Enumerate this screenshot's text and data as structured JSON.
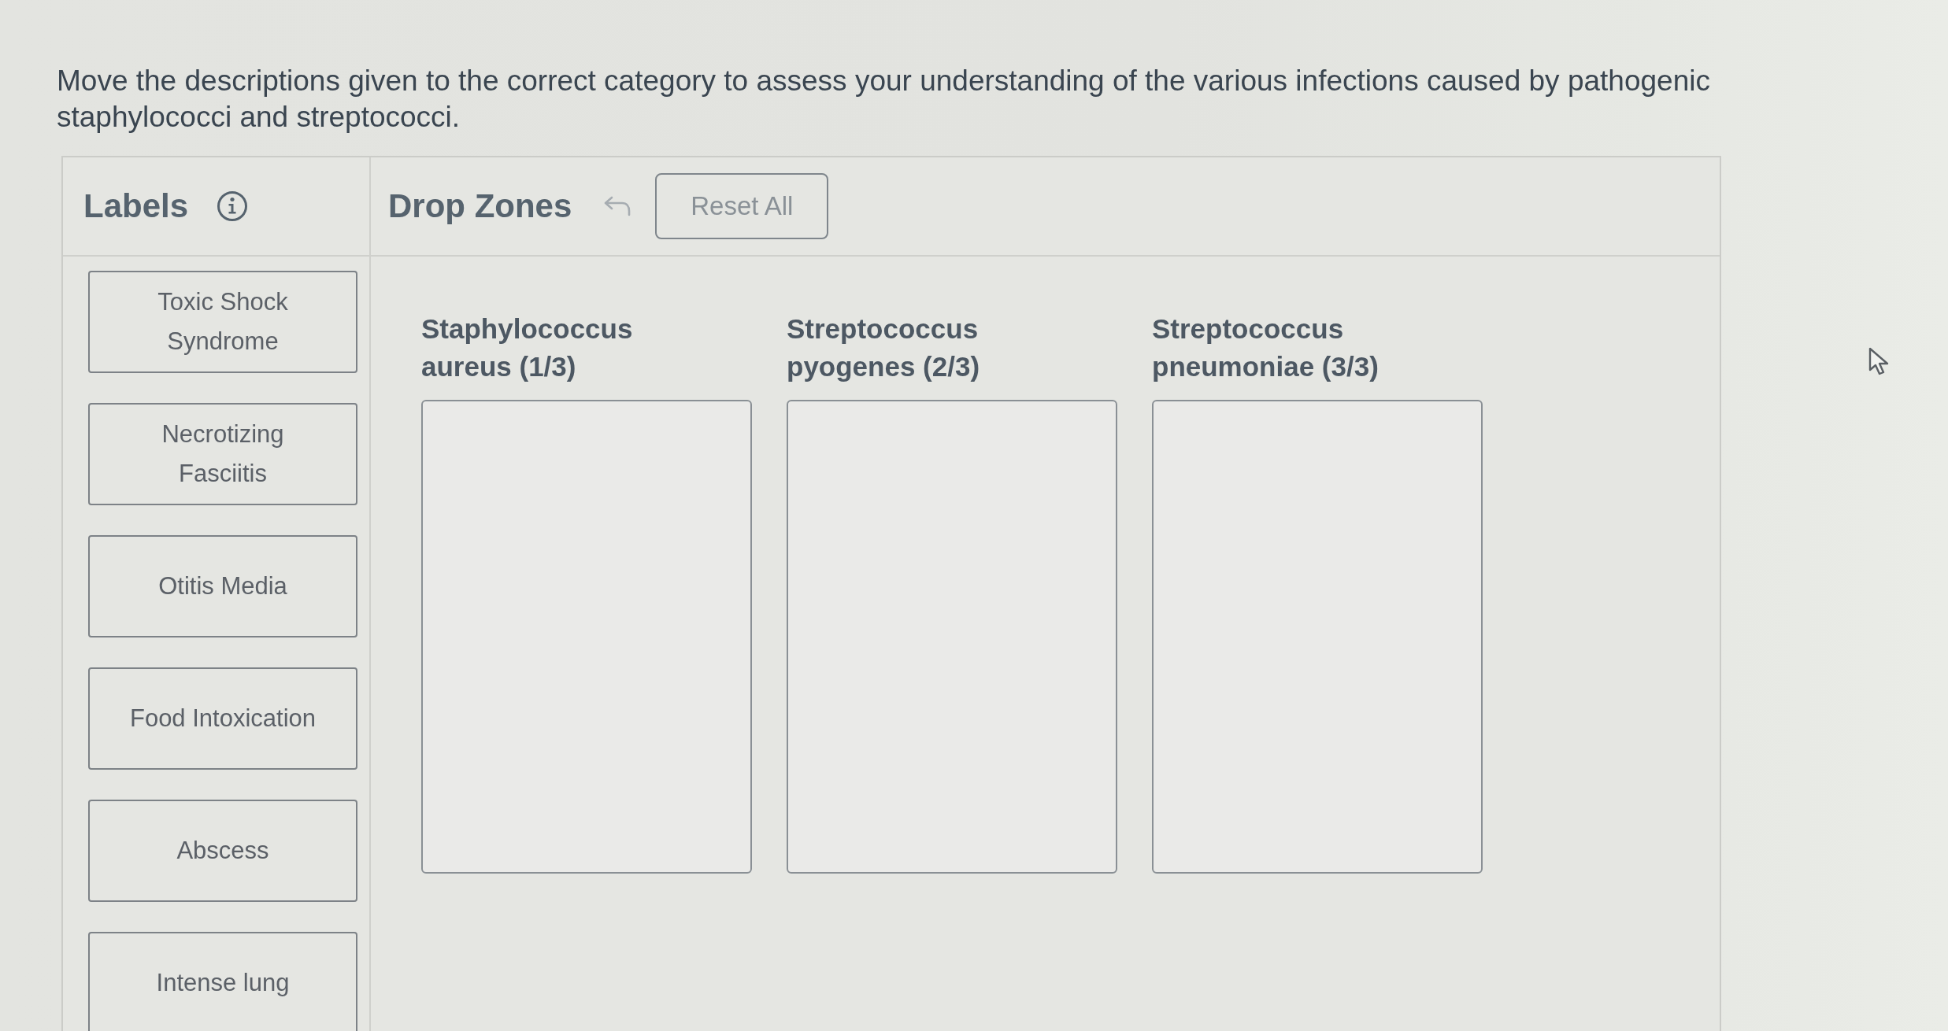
{
  "instructions": "Move the descriptions given to the correct category to assess your understanding of the various infections caused by pathogenic staphylococci and streptococci.",
  "labels_panel": {
    "title": "Labels",
    "labels": [
      "Toxic Shock Syndrome",
      "Necrotizing Fasciitis",
      "Otitis Media",
      "Food Intoxication",
      "Abscess",
      "Intense lung"
    ]
  },
  "drop_zones_panel": {
    "title": "Drop Zones",
    "reset_button": "Reset All",
    "zones": [
      {
        "title": "Staphylococcus aureus (1/3)"
      },
      {
        "title": "Streptococcus pyogenes (2/3)"
      },
      {
        "title": "Streptococcus pneumoniae (3/3)"
      }
    ]
  }
}
